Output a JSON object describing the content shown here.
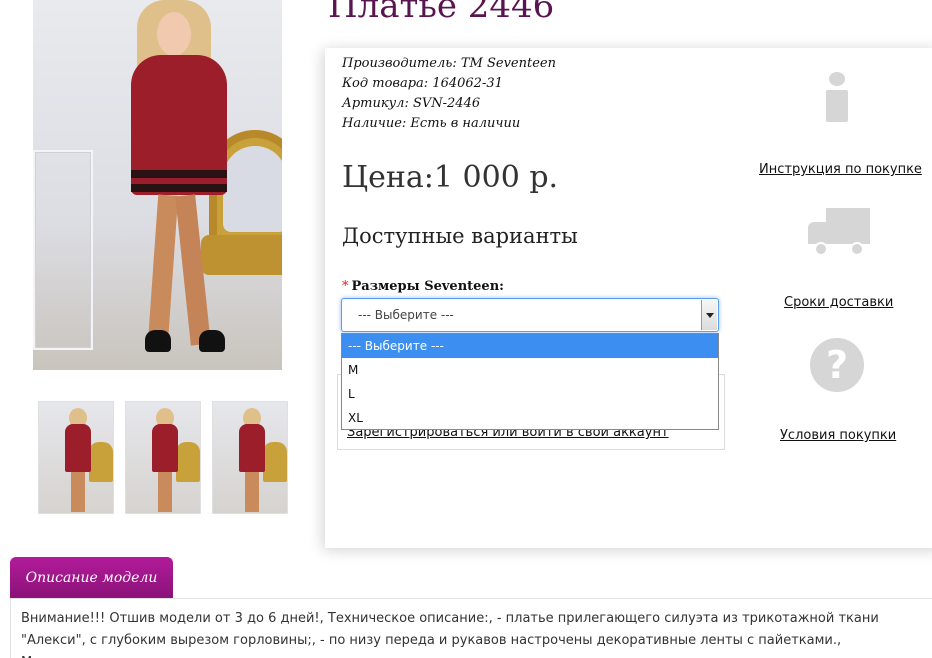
{
  "product": {
    "title": "Платье 2446"
  },
  "specs": {
    "manufacturer_label": "Производитель:",
    "manufacturer_value": "ТМ Seventeen",
    "code_label": "Код товара:",
    "code_value": "164062-31",
    "article_label": "Артикул:",
    "article_value": "SVN-2446",
    "stock_label": "Наличие:",
    "stock_value": "Есть в наличии"
  },
  "price": {
    "label": "Цена:",
    "value": "1 000 р."
  },
  "variants": {
    "title": "Доступные варианты",
    "required_mark": "*",
    "size_label": "Размеры Seventeen:",
    "selected": "--- Выберите ---",
    "options": [
      "--- Выберите ---",
      "M",
      "L",
      "XL"
    ]
  },
  "login": {
    "link": "Зарегистрироваться или войти в свой аккаунт"
  },
  "side": {
    "instructions": "Инструкция по покупке",
    "delivery": "Сроки доставки",
    "conditions": "Условия покупки"
  },
  "description": {
    "tab": "Описание модели",
    "text": "Внимание!!! Отшив модели от 3 до 6 дней!, Техническое описание:, - платье прилегающего силуэта из трикотажной ткани \"Алекси\", с глубоким вырезом горловины;, - по низу переда и рукавов настрочены декоративные ленты с пайетками., Материал: трикотаж"
  },
  "colors": {
    "title": "#5a1450",
    "tab": "#9a1588",
    "dropdown_selected": "#3c8ff0",
    "icon_gray": "#d6d6d6"
  }
}
